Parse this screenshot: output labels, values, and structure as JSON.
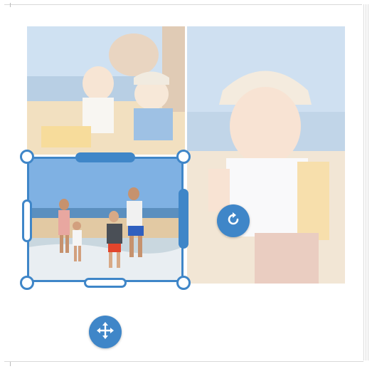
{
  "editor": {
    "accent_color": "#3f86c8",
    "photos": [
      {
        "name": "photo-beach-kids-group",
        "opacity": 0.55
      },
      {
        "name": "photo-toddler-sun-hat",
        "opacity": 0.55
      },
      {
        "name": "photo-family-running-beach",
        "opacity": 1.0,
        "selected": true
      }
    ],
    "controls": {
      "rotate_icon": "rotate-icon",
      "move_icon": "move-icon"
    }
  }
}
